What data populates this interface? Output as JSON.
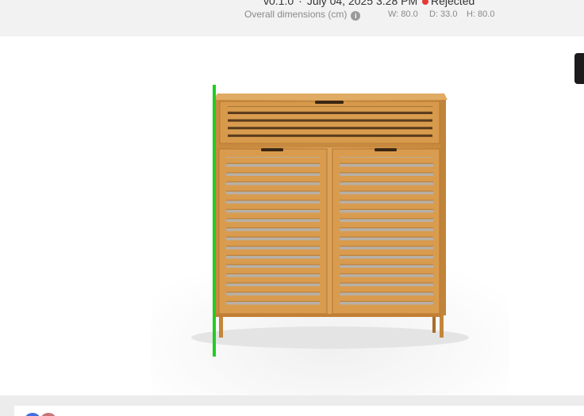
{
  "header": {
    "version": "v0.1.0",
    "date": "July 04, 2025 3:28 PM",
    "status": "Rejected",
    "status_color": "#e53935",
    "dimensions_label": "Overall dimensions (cm)",
    "info_icon": "info-icon",
    "width": "W: 80.0",
    "depth": "D: 33.0",
    "height": "H: 80.0"
  },
  "viewer": {
    "model": "bamboo storage cabinet with louvered drawer and two louvered doors",
    "measure_line_color": "#22cc22",
    "side_control_icon": "panel-toggle-icon"
  },
  "comments": {
    "avatars": [
      "avatar-user-1",
      "avatar-user-2"
    ]
  }
}
